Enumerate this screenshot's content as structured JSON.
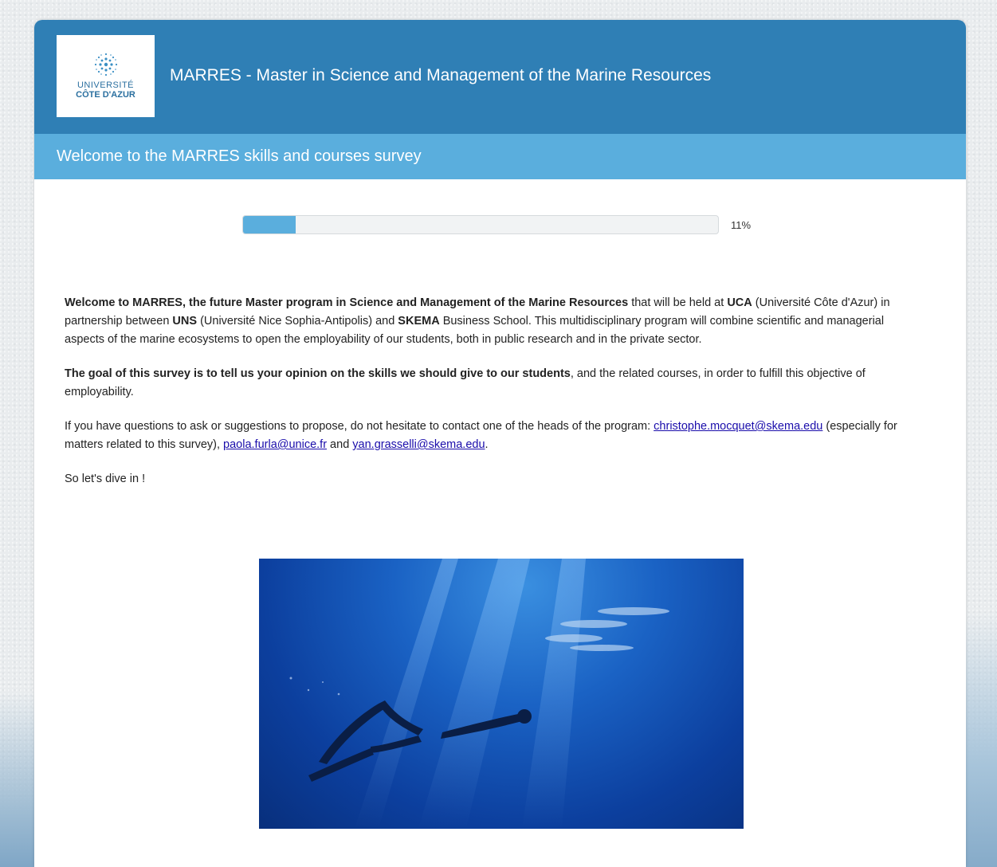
{
  "header": {
    "logo": {
      "line1": "UNIVERSITÉ",
      "line2": "CÔTE D'AZUR"
    },
    "title": "MARRES - Master in Science and Management of the Marine Resources"
  },
  "subheader": {
    "title": "Welcome to the MARRES skills and courses survey"
  },
  "progress": {
    "value": 11,
    "label": "11%"
  },
  "intro": {
    "p1": {
      "b1": "Welcome to MARRES, the future Master program in Science and Management of the Marine Resources",
      "t1": " that will be held at ",
      "b2": "UCA",
      "t2": " (Université Côte d'Azur) in partnership between ",
      "b3": "UNS",
      "t3": " (Université Nice Sophia-Antipolis) and ",
      "b4": "SKEMA",
      "t4": " Business School. This multidisciplinary program will combine scientific and managerial aspects of the marine ecosystems to open the employability of our students, both in public research and in the private sector."
    },
    "p2": {
      "b1": "The goal of this survey is to tell us your opinion on the skills we should give to our students",
      "t1": ", and the related courses, in order to fulfill this objective of employability."
    },
    "p3": {
      "t1": "If you have questions to ask or suggestions to propose, do not hesitate to contact one of the heads of the program: ",
      "link1": "christophe.mocquet@skema.edu",
      "t2": " (especially for matters related to this survey), ",
      "link2": "paola.furla@unice.fr",
      "t3": " and ",
      "link3": "yan.grasselli@skema.edu",
      "t4": "."
    },
    "p4": "So let's dive in !"
  },
  "colors": {
    "header_bg": "#2f7fb5",
    "subheader_bg": "#5aaedd",
    "progress_fill": "#5aaedd",
    "link": "#1a0dab"
  }
}
